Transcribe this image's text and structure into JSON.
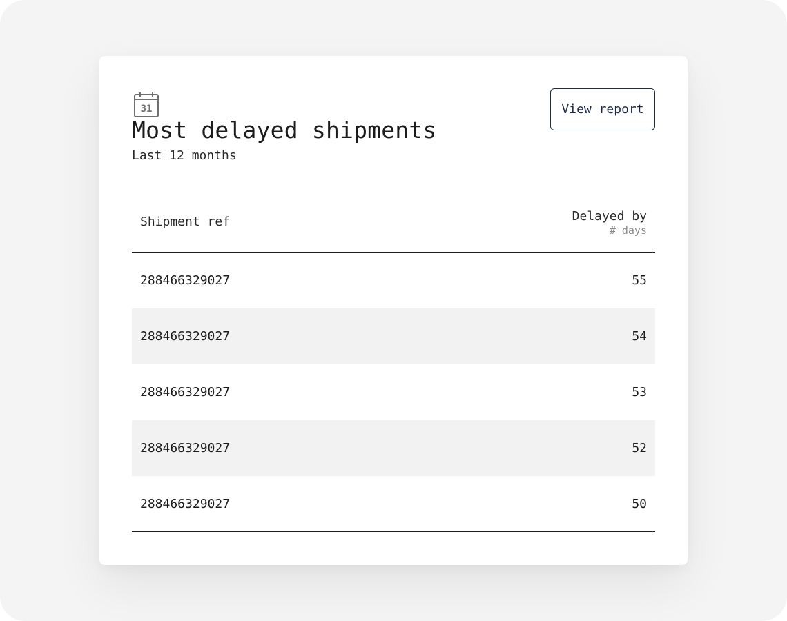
{
  "card": {
    "icon": "calendar-icon",
    "icon_text": "31",
    "title": "Most delayed shipments",
    "subtitle": "Last 12 months",
    "action_label": "View report"
  },
  "table": {
    "columns": {
      "ref": "Shipment ref",
      "delay": "Delayed by",
      "delay_unit": "# days"
    },
    "rows": [
      {
        "ref": "288466329027",
        "days": "55"
      },
      {
        "ref": "288466329027",
        "days": "54"
      },
      {
        "ref": "288466329027",
        "days": "53"
      },
      {
        "ref": "288466329027",
        "days": "52"
      },
      {
        "ref": "288466329027",
        "days": "50"
      }
    ]
  },
  "colors": {
    "page_background": "#f4f4f4",
    "card_background": "#ffffff",
    "button_border": "#1d2b44",
    "row_shade": "#f2f2f2"
  }
}
